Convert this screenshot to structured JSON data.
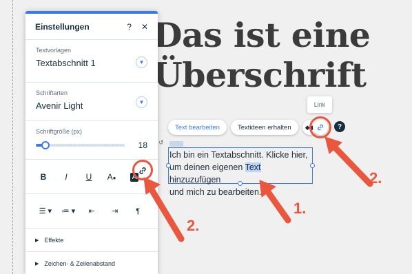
{
  "heading": {
    "line1": "Das ist eine",
    "line2": "Überschrift"
  },
  "panel": {
    "title": "Einstellungen",
    "help_label": "?",
    "close_label": "✕",
    "textvorlagen_label": "Textvorlagen",
    "textvorlagen_value": "Textabschnitt 1",
    "schriftarten_label": "Schriftarten",
    "schriftarten_value": "Avenir Light",
    "schriftgroesse_label": "Schriftgröße (px)",
    "schriftgroesse_value": "18",
    "format": {
      "bold": "B",
      "italic": "I",
      "underline": "U",
      "color": "A",
      "highlight": "A"
    },
    "effekte_label": "Effekte",
    "zeichen_label": "Zeichen- & Zeilenabstand"
  },
  "toolbar": {
    "edit_text": "Text bearbeiten",
    "text_ideas": "Textideen erhalten",
    "link_tooltip": "Link",
    "help": "?"
  },
  "textbox": {
    "line1": "Ich bin ein Textabschnitt. Klicke hier,",
    "line2_before": "um deinen eigenen ",
    "line2_selected": "Text",
    "line2_after": " hinzuzufügen",
    "line3": "und mich zu bearbeiten."
  },
  "annotations": {
    "step1": "1.",
    "step2_left": "2.",
    "step2_right": "2."
  },
  "colors": {
    "accent": "#3b7be8",
    "annotation": "#e9573f",
    "heading": "#3b3b3b"
  }
}
